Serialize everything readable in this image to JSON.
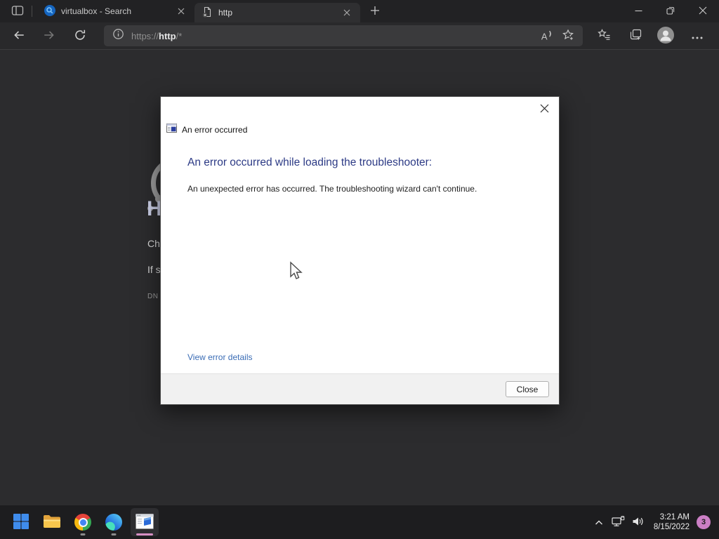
{
  "browser": {
    "tabs": [
      {
        "title": "virtualbox - Search"
      },
      {
        "title": "http"
      }
    ],
    "address": {
      "scheme": "https://",
      "host": "http",
      "path": "/*"
    }
  },
  "error_page": {
    "heading_fragment": "H",
    "line1_fragment": "Ch",
    "line2_fragment": "If s",
    "line3_fragment": "DN"
  },
  "dialog": {
    "title": "An error occurred",
    "heading": "An error occurred while loading the troubleshooter:",
    "message": "An unexpected error has occurred. The troubleshooting wizard can't continue.",
    "details_link": "View error details",
    "close_label": "Close"
  },
  "taskbar": {
    "clock": {
      "time": "3:21 AM",
      "date": "8/15/2022"
    },
    "notification_badge": "3"
  },
  "colors": {
    "dialog_heading": "#2c3a85",
    "details_link": "#3a6cb5",
    "badge_accent": "#cb7fc5",
    "active_app_indicator": "#d78fc4",
    "dimmed_background": "#2c2c2e"
  }
}
